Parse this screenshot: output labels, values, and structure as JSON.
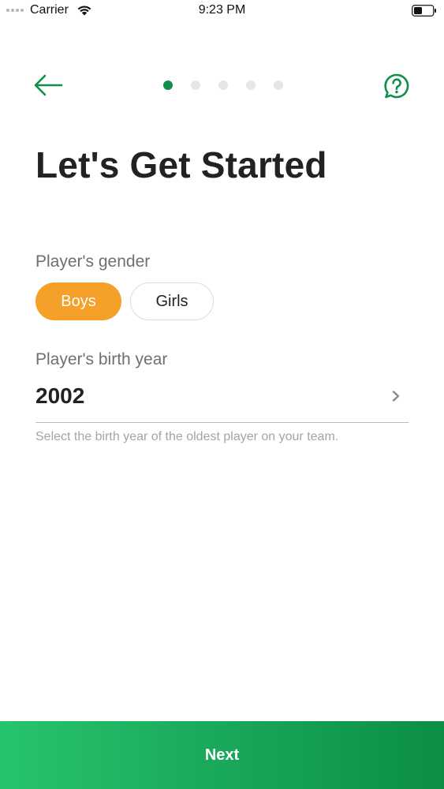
{
  "status_bar": {
    "carrier": "Carrier",
    "time": "9:23 PM"
  },
  "nav": {
    "back_icon": "arrow-left-icon",
    "help_icon": "question-chat-icon",
    "progress": {
      "total_steps": 5,
      "current_step": 1
    }
  },
  "page": {
    "title": "Let's Get Started"
  },
  "gender": {
    "label": "Player's gender",
    "options": [
      "Boys",
      "Girls"
    ],
    "selected": "Boys"
  },
  "birth_year": {
    "label": "Player's birth year",
    "value": "2002",
    "helper": "Select the birth year of the oldest player on your team."
  },
  "footer": {
    "next_label": "Next"
  },
  "colors": {
    "accent_green": "#0f8f4a",
    "selected_orange": "#f5a028",
    "next_gradient_start": "#26c46e",
    "next_gradient_end": "#0b8f44"
  }
}
